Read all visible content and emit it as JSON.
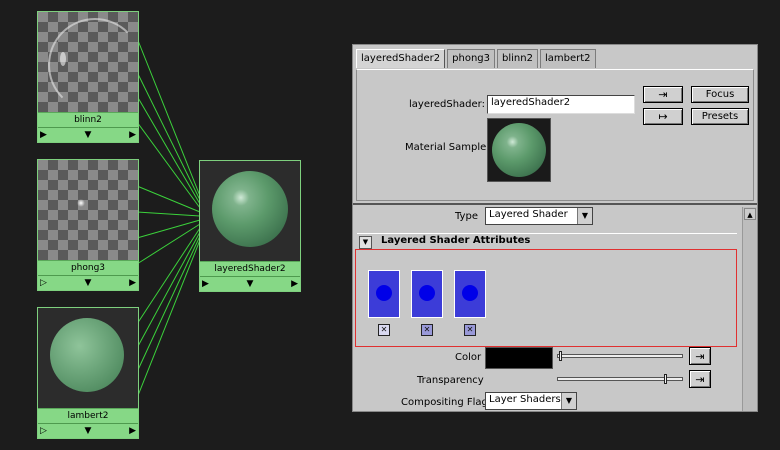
{
  "graph": {
    "nodes": [
      {
        "name": "blinn2",
        "icon_left": "play-icon",
        "icon_mid": "expand-down-icon",
        "icon_right": "play-icon"
      },
      {
        "name": "phong3",
        "icon_left": "play-outline-icon",
        "icon_mid": "expand-down-icon",
        "icon_right": "play-icon"
      },
      {
        "name": "lambert2",
        "icon_left": "play-outline-icon",
        "icon_mid": "expand-down-icon",
        "icon_right": "play-icon"
      },
      {
        "name": "layeredShader2",
        "icon_left": "play-icon",
        "icon_mid": "expand-down-icon",
        "icon_right": "play-icon"
      }
    ],
    "wire_color": "#3bd23b"
  },
  "editor": {
    "tabs": [
      "layeredShader2",
      "phong3",
      "blinn2",
      "lambert2"
    ],
    "active_tab": "layeredShader2",
    "shader_label": "layeredShader:",
    "shader_value": "layeredShader2",
    "focus_label": "Focus",
    "presets_label": "Presets",
    "material_sample_label": "Material Sample",
    "type_label": "Type",
    "type_value": "Layered Shader",
    "section_title": "Layered Shader Attributes",
    "layers": [
      {
        "color": "#3c3cd8",
        "selected": true
      },
      {
        "color": "#3c3cd8",
        "selected": false
      },
      {
        "color": "#3c3cd8",
        "selected": false
      }
    ],
    "color_label": "Color",
    "color_swatch": "#000000",
    "color_slider": 0.0,
    "transparency_label": "Transparency",
    "transparency_slider": 0.98,
    "compositing_label": "Compositing Flag",
    "compositing_value": "Layer Shaders",
    "highlight_color": "#e03030"
  }
}
